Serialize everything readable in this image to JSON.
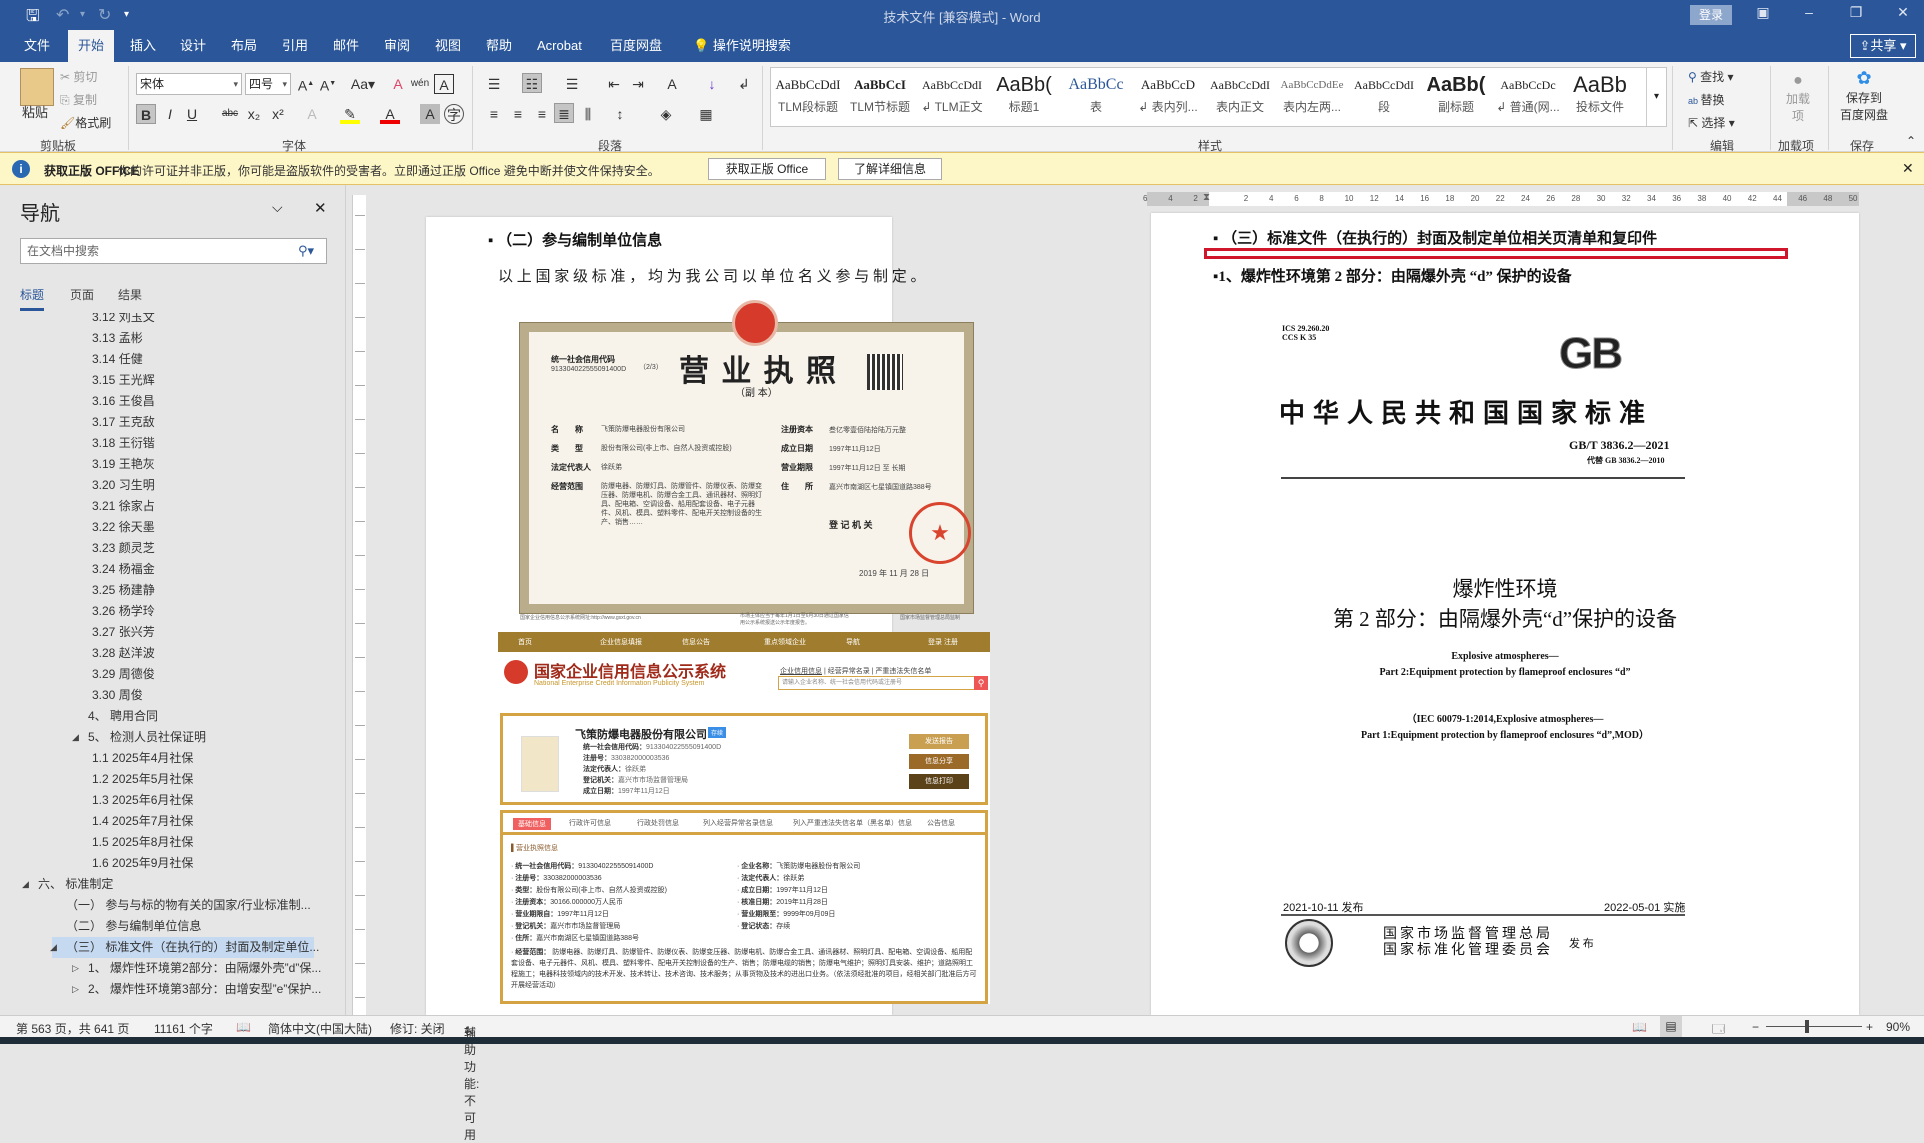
{
  "titlebar": {
    "title": "技术文件 [兼容模式] - Word",
    "login": "登录"
  },
  "tabs": [
    "文件",
    "开始",
    "插入",
    "设计",
    "布局",
    "引用",
    "邮件",
    "审阅",
    "视图",
    "帮助",
    "Acrobat",
    "百度网盘",
    "操作说明搜索"
  ],
  "share": "共享",
  "ribbon": {
    "clipboard": {
      "paste": "粘贴",
      "cut": "剪切",
      "copy": "复制",
      "format_painter": "格式刷",
      "label": "剪贴板"
    },
    "font": {
      "name": "宋体",
      "size": "四号",
      "label": "字体"
    },
    "paragraph": {
      "label": "段落"
    },
    "styles": {
      "label": "样式",
      "items": [
        {
          "preview": "AaBbCcDdI",
          "name": "TLM段标题"
        },
        {
          "preview": "AaBbCcI",
          "name": "TLM节标题"
        },
        {
          "preview": "AaBbCcDdI",
          "name": "↲ TLM正文"
        },
        {
          "preview": "AaBb(",
          "name": "标题1"
        },
        {
          "preview": "AaBbCc",
          "name": "表"
        },
        {
          "preview": "AaBbCcD",
          "name": "↲ 表内列..."
        },
        {
          "preview": "AaBbCcDdI",
          "name": "表内正文"
        },
        {
          "preview": "AaBbCcDdEe",
          "name": "表内左两..."
        },
        {
          "preview": "AaBbCcDdI",
          "name": "段"
        },
        {
          "preview": "AaBb(",
          "name": "副标题"
        },
        {
          "preview": "AaBbCcDc",
          "name": "↲ 普通(网..."
        },
        {
          "preview": "AaBb",
          "name": "投标文件"
        }
      ]
    },
    "editing": {
      "find": "查找",
      "replace": "替换",
      "select": "选择",
      "label": "编辑"
    },
    "addins": {
      "btn": "加载项",
      "label": "加载项"
    },
    "save": {
      "btn1": "保存到",
      "btn2": "百度网盘",
      "label": "保存"
    }
  },
  "msgbar": {
    "title": "获取正版 OFFICE",
    "text": "你的许可证并非正版，你可能是盗版软件的受害者。立即通过正版 Office 避免中断并使文件保持安全。",
    "btn1": "获取正版 Office",
    "btn2": "了解详细信息"
  },
  "nav": {
    "title": "导航",
    "search_placeholder": "在文档中搜索",
    "tabs": [
      "标题",
      "页面",
      "结果"
    ],
    "items": [
      {
        "label": "3.12  刘玉文",
        "level": 3
      },
      {
        "label": "3.13  孟彬",
        "level": 3
      },
      {
        "label": "3.14  任健",
        "level": 3
      },
      {
        "label": "3.15  王光辉",
        "level": 3
      },
      {
        "label": "3.16  王俊昌",
        "level": 3
      },
      {
        "label": "3.17  王克敌",
        "level": 3
      },
      {
        "label": "3.18  王衍锴",
        "level": 3
      },
      {
        "label": "3.19  王艳灰",
        "level": 3
      },
      {
        "label": "3.20  习生明",
        "level": 3
      },
      {
        "label": "3.21  徐家占",
        "level": 3
      },
      {
        "label": "3.22  徐天墨",
        "level": 3
      },
      {
        "label": "3.23  颜灵芝",
        "level": 3
      },
      {
        "label": "3.24  杨福金",
        "level": 3
      },
      {
        "label": "3.25  杨建静",
        "level": 3
      },
      {
        "label": "3.26  杨学玲",
        "level": 3
      },
      {
        "label": "3.27  张兴芳",
        "level": 3
      },
      {
        "label": "3.28  赵洋波",
        "level": 3
      },
      {
        "label": "3.29  周德俊",
        "level": 3
      },
      {
        "label": "3.30  周俊",
        "level": 3
      },
      {
        "label": "4、  聘用合同",
        "level": 2
      },
      {
        "label": "5、  检测人员社保证明",
        "level": 2,
        "toggle": "◢"
      },
      {
        "label": "1.1  2025年4月社保",
        "level": 3
      },
      {
        "label": "1.2  2025年5月社保",
        "level": 3
      },
      {
        "label": "1.3  2025年6月社保",
        "level": 3
      },
      {
        "label": "1.4  2025年7月社保",
        "level": 3
      },
      {
        "label": "1.5  2025年8月社保",
        "level": 3
      },
      {
        "label": "1.6  2025年9月社保",
        "level": 3
      },
      {
        "label": "六、  标准制定",
        "level": 0,
        "toggle": "◢"
      },
      {
        "label": "（一）  参与与标的物有关的国家/行业标准制...",
        "level": 1
      },
      {
        "label": "（二）  参与编制单位信息",
        "level": 1
      },
      {
        "label": "（三）  标准文件（在执行的）封面及制定单位...",
        "level": 1,
        "toggle": "◢",
        "selected": true
      },
      {
        "label": "1、  爆炸性环境第2部分：由隔爆外壳”d”保...",
        "level": 2,
        "toggle": "▷"
      },
      {
        "label": "2、  爆炸性环境第3部分：由增安型”e”保护...",
        "level": 2,
        "toggle": "▷"
      }
    ]
  },
  "left_page": {
    "heading": "（二）参与编制单位信息",
    "body": "以 上 国 家 级 标 准 ， 均 为 我 公 司 以 单 位 名 义 参 与 制 定 。",
    "license": {
      "title": "营 业 执 照",
      "subtitle": "（副 本）",
      "code_label": "统一社会信用代码",
      "code": "913304022555091400D",
      "copy_no": "（2/3）",
      "fields_left": [
        [
          "名　　称",
          "飞策防爆电器股份有限公司"
        ],
        [
          "类　　型",
          "股份有限公司(非上市、自然人投资或控股)"
        ],
        [
          "法定代表人",
          "徐跃弟"
        ],
        [
          "经营范围",
          "防爆电器、防爆灯具、防爆管件、防爆仪表、防爆变压器、防爆电机、防爆合金工具、通讯器材、照明灯具、配电箱、空调设备、船用配套设备、电子元器件、风机、模具、塑料零件、配电开关控制设备的生产、销售……"
        ]
      ],
      "fields_right": [
        [
          "注册资本",
          "叁亿零壹佰陆拾陆万元整"
        ],
        [
          "成立日期",
          "1997年11月12日"
        ],
        [
          "营业期限",
          "1997年11月12日 至 长期"
        ],
        [
          "住　　所",
          "嘉兴市南湖区七星镇国道路388号"
        ]
      ],
      "authority": "登 记 机 关",
      "date": "2019 年 11 月 28 日",
      "footer_left": "国家企业信用信息公示系统网址:http://www.gsxt.gov.cn",
      "footer_mid": "市场主体应当于每年1月1日至6月30日通过国家信用公示系统报送公示年度报告。",
      "footer_right": "国家市场监督管理总局监制"
    },
    "credit": {
      "nav": [
        "首页",
        "企业信息填报",
        "信息公告",
        "重点领域企业",
        "导航",
        "登录 注册"
      ],
      "system_name": "国家企业信用信息公示系统",
      "system_name_en": "National Enterprise Credit Information Publicity System",
      "search_tabs": [
        "企业信用信息",
        "经营异常名录",
        "严重违法失信名单"
      ],
      "search_placeholder": "请输入企业名称、统一社会信用代码或注册号",
      "company": "飞策防爆电器股份有限公司",
      "status": "存续",
      "summary": [
        [
          "统一社会信用代码：",
          "913304022555091400D"
        ],
        [
          "注册号：",
          "330382000003536"
        ],
        [
          "法定代表人：",
          "徐跃弟"
        ],
        [
          "登记机关：",
          "嘉兴市市场监督管理局"
        ],
        [
          "成立日期：",
          "1997年11月12日"
        ]
      ],
      "buttons": [
        "发送报告",
        "信息分享",
        "信息打印"
      ],
      "tabs": [
        "基础信息",
        "行政许可信息",
        "行政处罚信息",
        "列入经营异常名录信息",
        "列入严重违法失信名单（黑名单）信息",
        "公告信息"
      ],
      "section": "营业执照信息",
      "details_left": [
        [
          "统一社会信用代码：",
          "913304022555091400D"
        ],
        [
          "注册号：",
          "330382000003536"
        ],
        [
          "类型：",
          "股份有限公司(非上市、自然人投资或控股)"
        ],
        [
          "注册资本：",
          "30166.000000万人民币"
        ],
        [
          "营业期限自：",
          "1997年11月12日"
        ],
        [
          "登记机关：",
          "嘉兴市市场监督管理局"
        ],
        [
          "住所：",
          "嘉兴市南湖区七星镇国道路388号"
        ]
      ],
      "details_right": [
        [
          "企业名称：",
          "飞策防爆电器股份有限公司"
        ],
        [
          "法定代表人：",
          "徐跃弟"
        ],
        [
          "成立日期：",
          "1997年11月12日"
        ],
        [
          "核准日期：",
          "2019年11月28日"
        ],
        [
          "营业期限至：",
          "9999年09月09日"
        ],
        [
          "登记状态：",
          "存续"
        ]
      ],
      "scope_label": "经营范围：",
      "scope": "防爆电器、防爆灯具、防爆管件、防爆仪表、防爆变压器、防爆电机、防爆合金工具、通讯器材、照明灯具、配电箱、空调设备、船用配套设备、电子元器件、风机、模具、塑料零件、配电开关控制设备的生产、销售；防爆电缆的销售；防爆电气维护；照明灯具安装、维护；道路照明工程施工；电器科技领域内的技术开发、技术转让、技术咨询、技术服务；从事货物及技术的进出口业务。（依法须经批准的项目，经相关部门批准后方可开展经营活动）"
    }
  },
  "right_page": {
    "ruler": [
      "6",
      "4",
      "2",
      "",
      "2",
      "4",
      "6",
      "8",
      "10",
      "12",
      "14",
      "16",
      "18",
      "20",
      "22",
      "24",
      "26",
      "28",
      "30",
      "32",
      "34",
      "36",
      "38",
      "40",
      "42",
      "44",
      "46",
      "48",
      "50"
    ],
    "heading": "（三）标准文件（在执行的）封面及制定单位相关页清单和复印件",
    "subheading": "1、爆炸性环境第 2 部分：由隔爆外壳 “d” 保护的设备",
    "cover": {
      "ics": "ICS 29.260.20",
      "ccs": "CCS K 35",
      "logo": "GB",
      "national": "中华人民共和国国家标准",
      "std_no": "GB/T 3836.2—2021",
      "replaces": "代替 GB 3836.2—2010",
      "title1": "爆炸性环境",
      "title2": "第 2 部分：由隔爆外壳“d”保护的设备",
      "en1": "Explosive atmospheres—",
      "en2": "Part 2:Equipment protection by flameproof enclosures “d”",
      "iec1": "（IEC 60079-1:2014,Explosive atmospheres—",
      "iec2": "Part 1:Equipment protection by flameproof enclosures “d”,MOD）",
      "issued": "2021-10-11 发布",
      "effective": "2022-05-01 实施",
      "org1": "国家市场监督管理总局",
      "org2": "国家标准化管理委员会",
      "publish": "发 布"
    },
    "highlight_color": "#d0162a"
  },
  "status": {
    "page": "第 563 页，共 641 页",
    "words": "11161 个字",
    "language": "简体中文(中国大陆)",
    "track": "修订: 关闭",
    "accessibility": "辅助功能: 不可用",
    "zoom": "90%",
    "zoom_percent": 90
  }
}
